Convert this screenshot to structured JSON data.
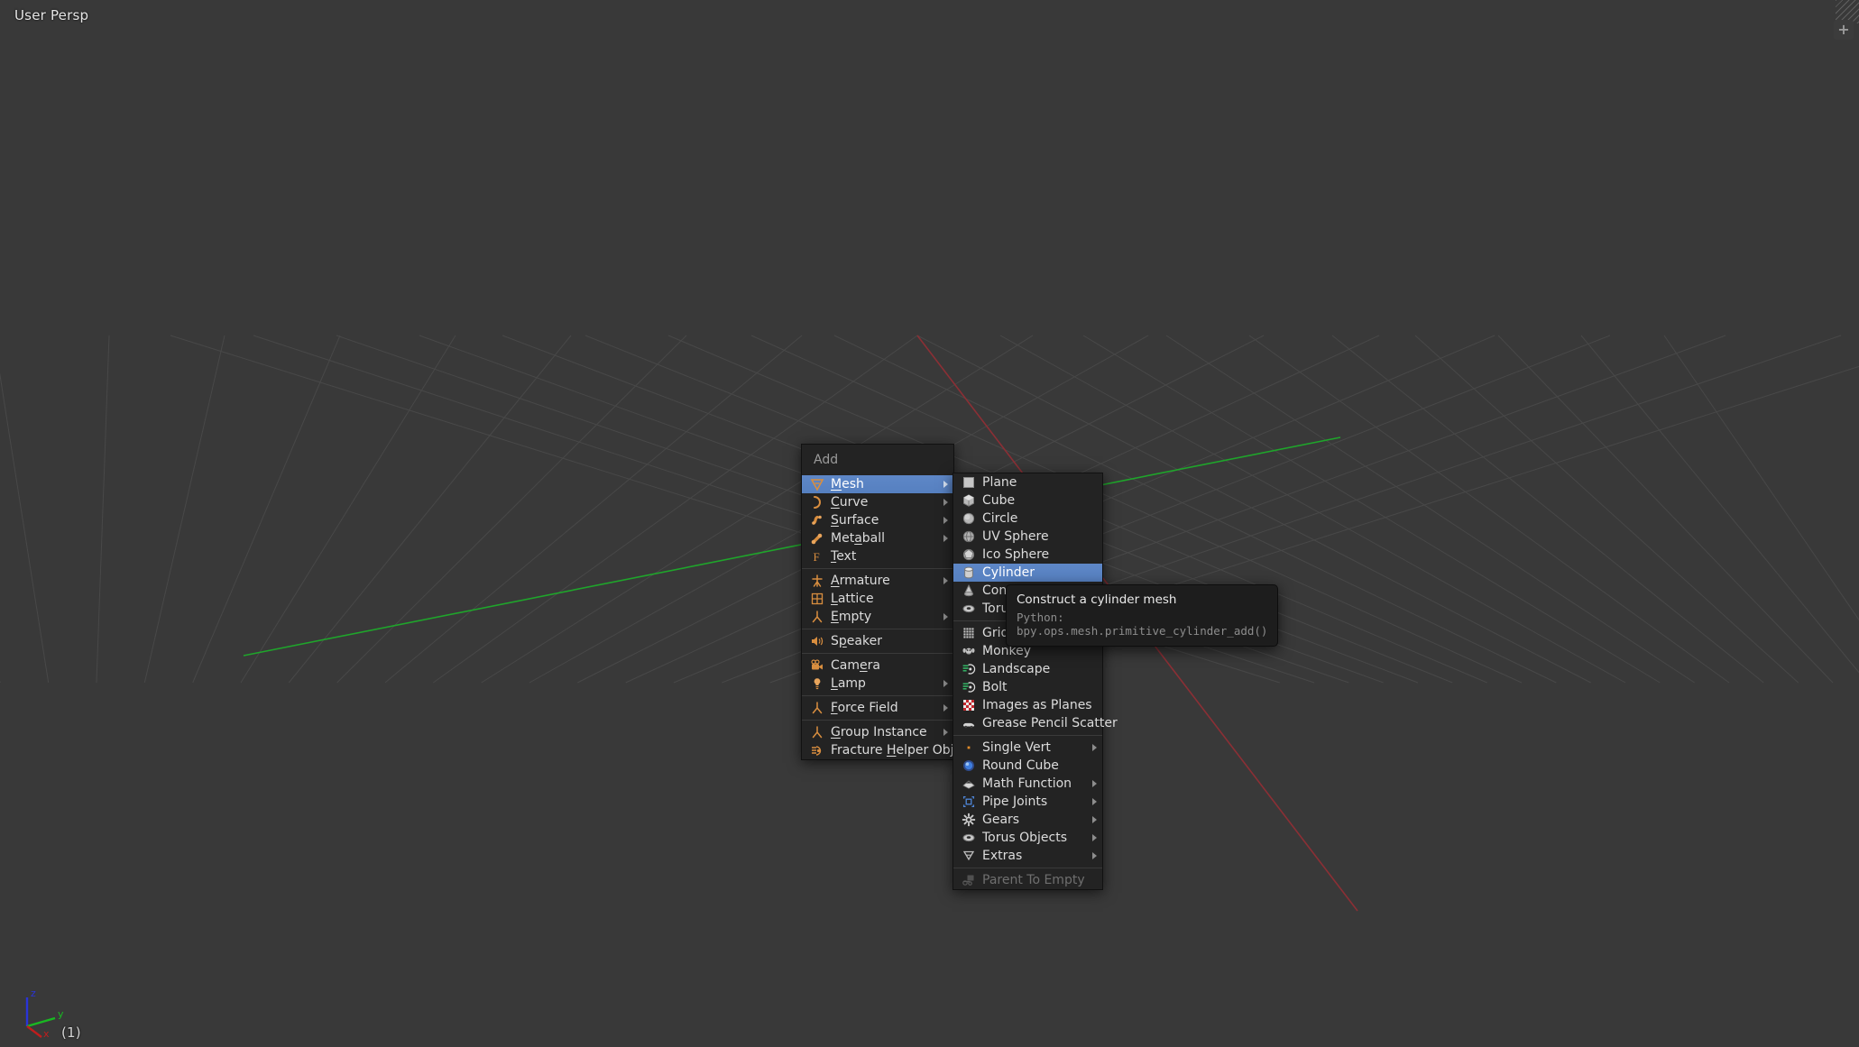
{
  "viewport": {
    "view_label": "User Persp",
    "frame_label": "(1)",
    "background_color": "#393939",
    "grid_color": "#4b4b4b",
    "x_axis_color": "#8b2f35",
    "y_axis_color": "#1fa52b",
    "gizmo": {
      "z_label": "z",
      "y_label": "y",
      "x_label": "x",
      "z_color": "#2a34d8",
      "y_color": "#19b822",
      "x_color": "#c01d1d"
    }
  },
  "corner": {
    "add_button_label": "+"
  },
  "add_menu": {
    "title": "Add",
    "highlight_color": "#5680c0",
    "items": [
      {
        "label": "Mesh",
        "icon": "mesh-icon",
        "submenu": true,
        "highlighted": true,
        "accel": "M"
      },
      {
        "label": "Curve",
        "icon": "curve-icon",
        "submenu": true,
        "highlighted": false,
        "accel": "C"
      },
      {
        "label": "Surface",
        "icon": "surface-icon",
        "submenu": true,
        "highlighted": false,
        "accel": "S"
      },
      {
        "label": "Metaball",
        "icon": "metaball-icon",
        "submenu": true,
        "highlighted": false,
        "accel": "a"
      },
      {
        "label": "Text",
        "icon": "text-icon",
        "submenu": false,
        "highlighted": false,
        "accel": "T"
      },
      {
        "separator": true
      },
      {
        "label": "Armature",
        "icon": "armature-icon",
        "submenu": true,
        "highlighted": false,
        "accel": "A"
      },
      {
        "label": "Lattice",
        "icon": "lattice-icon",
        "submenu": false,
        "highlighted": false,
        "accel": "L"
      },
      {
        "label": "Empty",
        "icon": "empty-icon",
        "submenu": true,
        "highlighted": false,
        "accel": "E"
      },
      {
        "separator": true
      },
      {
        "label": "Speaker",
        "icon": "speaker-icon",
        "submenu": false,
        "highlighted": false,
        "accel": "p"
      },
      {
        "separator": true
      },
      {
        "label": "Camera",
        "icon": "camera-icon",
        "submenu": false,
        "highlighted": false,
        "accel": "e"
      },
      {
        "label": "Lamp",
        "icon": "lamp-icon",
        "submenu": true,
        "highlighted": false,
        "accel": "L"
      },
      {
        "separator": true
      },
      {
        "label": "Force Field",
        "icon": "force-field-icon",
        "submenu": true,
        "highlighted": false,
        "accel": "F"
      },
      {
        "separator": true
      },
      {
        "label": "Group Instance",
        "icon": "group-instance-icon",
        "submenu": true,
        "highlighted": false,
        "accel": "G"
      },
      {
        "label": "Fracture Helper Objects",
        "icon": "fracture-helper-icon",
        "submenu": true,
        "highlighted": false,
        "accel": "H"
      }
    ]
  },
  "mesh_submenu": {
    "items": [
      {
        "label": "Plane",
        "icon": "plane-icon",
        "submenu": false,
        "highlighted": false
      },
      {
        "label": "Cube",
        "icon": "cube-icon",
        "submenu": false,
        "highlighted": false
      },
      {
        "label": "Circle",
        "icon": "circle-icon",
        "submenu": false,
        "highlighted": false
      },
      {
        "label": "UV Sphere",
        "icon": "uv-sphere-icon",
        "submenu": false,
        "highlighted": false
      },
      {
        "label": "Ico Sphere",
        "icon": "ico-sphere-icon",
        "submenu": false,
        "highlighted": false
      },
      {
        "label": "Cylinder",
        "icon": "cylinder-icon",
        "submenu": false,
        "highlighted": true
      },
      {
        "label": "Cone",
        "icon": "cone-icon",
        "submenu": false,
        "highlighted": false
      },
      {
        "label": "Torus",
        "icon": "torus-icon",
        "submenu": false,
        "highlighted": false
      },
      {
        "separator": true
      },
      {
        "label": "Grid",
        "icon": "grid-icon",
        "submenu": false,
        "highlighted": false
      },
      {
        "label": "Monkey",
        "icon": "monkey-icon",
        "submenu": false,
        "highlighted": false
      },
      {
        "label": "Landscape",
        "icon": "script-icon",
        "submenu": false,
        "highlighted": false
      },
      {
        "label": "Bolt",
        "icon": "script-icon",
        "submenu": false,
        "highlighted": false
      },
      {
        "label": "Images as Planes",
        "icon": "checker-icon",
        "submenu": false,
        "highlighted": false
      },
      {
        "label": "Grease Pencil Scatter",
        "icon": "grease-pencil-icon",
        "submenu": false,
        "highlighted": false
      },
      {
        "separator": true
      },
      {
        "label": "Single Vert",
        "icon": "vertex-icon",
        "submenu": true,
        "highlighted": false
      },
      {
        "label": "Round Cube",
        "icon": "round-cube-icon",
        "submenu": false,
        "highlighted": false
      },
      {
        "label": "Math Function",
        "icon": "math-icon",
        "submenu": true,
        "highlighted": false
      },
      {
        "label": "Pipe Joints",
        "icon": "pipe-joints-icon",
        "submenu": true,
        "highlighted": false
      },
      {
        "label": "Gears",
        "icon": "gear-icon",
        "submenu": true,
        "highlighted": false
      },
      {
        "label": "Torus Objects",
        "icon": "torus-icon",
        "submenu": true,
        "highlighted": false
      },
      {
        "label": "Extras",
        "icon": "extras-icon",
        "submenu": true,
        "highlighted": false
      },
      {
        "separator": true
      },
      {
        "label": "Parent To Empty",
        "icon": "parent-empty-icon",
        "submenu": false,
        "highlighted": false,
        "disabled": true
      }
    ]
  },
  "tooltip": {
    "title": "Construct a cylinder mesh",
    "python": "Python: bpy.ops.mesh.primitive_cylinder_add()"
  }
}
